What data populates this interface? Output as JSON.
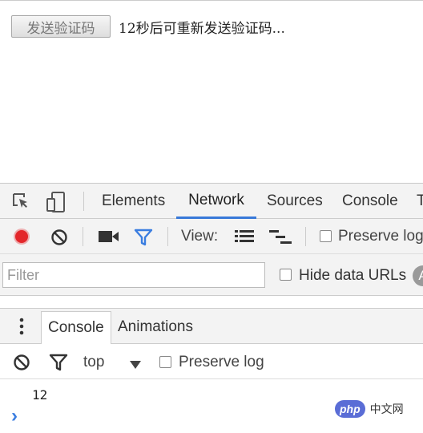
{
  "page": {
    "send_button": "发送验证码",
    "countdown_text": "12秒后可重新发送验证码..."
  },
  "devtools": {
    "tabs": [
      "Elements",
      "Network",
      "Sources",
      "Console",
      "T"
    ],
    "active_tab": "Network",
    "network_toolbar": {
      "view_label": "View:",
      "preserve_log_label": "Preserve log",
      "record_color": "#e3262a",
      "filter_active_color": "#3a7de0"
    },
    "filter": {
      "placeholder": "Filter",
      "hide_data_urls_label": "Hide data URLs",
      "all_chip": "A"
    },
    "drawer": {
      "tabs": [
        "Console",
        "Animations"
      ],
      "active_tab": "Console"
    },
    "console_toolbar": {
      "context": "top",
      "preserve_log_label": "Preserve log"
    },
    "console_output": [
      "12"
    ],
    "prompt_symbol": "›"
  },
  "watermark": {
    "logo_text": "php",
    "site_text": "中文网"
  }
}
